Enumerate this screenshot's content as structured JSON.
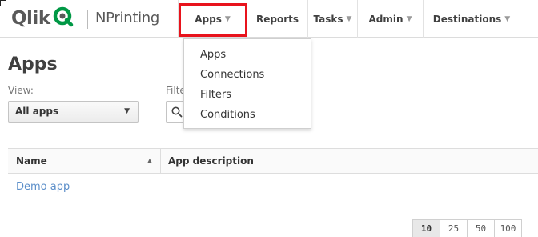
{
  "header": {
    "logo_text": "Qlik",
    "product_name": "NPrinting",
    "brand_green": "#009845",
    "highlight_color": "#e8131c"
  },
  "nav": {
    "apps": "Apps",
    "reports": "Reports",
    "tasks": "Tasks",
    "admin": "Admin",
    "destinations": "Destinations"
  },
  "dropdown": {
    "items": [
      "Apps",
      "Connections",
      "Filters",
      "Conditions"
    ]
  },
  "page": {
    "title": "Apps",
    "view_label": "View:",
    "view_value": "All apps",
    "filter_label": "Filter"
  },
  "table": {
    "col_name": "Name",
    "col_desc": "App description",
    "rows": [
      "Demo app"
    ]
  },
  "pager": {
    "sizes": [
      "10",
      "25",
      "50",
      "100"
    ],
    "active": "10"
  },
  "icons": {
    "dropdown_caret": "chevron-down-icon",
    "sort": "sort-ascending-icon",
    "search": "search-icon"
  }
}
